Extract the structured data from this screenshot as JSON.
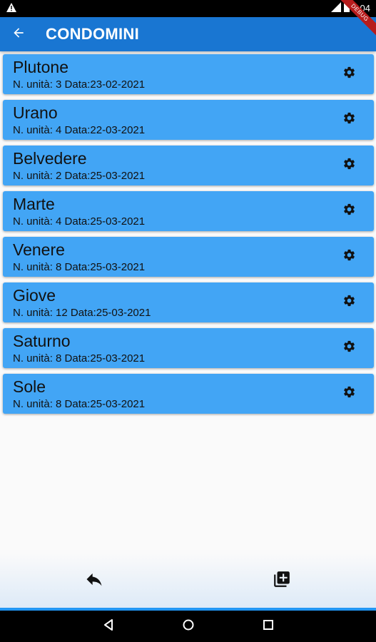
{
  "status_bar": {
    "time": "6:04",
    "debug_label": "DEBUG"
  },
  "app_bar": {
    "title": "CONDOMINI"
  },
  "condomini": [
    {
      "name": "Plutone",
      "details": "N. unità: 3 Data:23-02-2021"
    },
    {
      "name": "Urano",
      "details": "N. unità: 4 Data:22-03-2021"
    },
    {
      "name": "Belvedere",
      "details": "N. unità: 2 Data:25-03-2021"
    },
    {
      "name": "Marte",
      "details": "N. unità: 4 Data:25-03-2021"
    },
    {
      "name": "Venere",
      "details": "N. unità: 8 Data:25-03-2021"
    },
    {
      "name": "Giove",
      "details": "N. unità: 12 Data:25-03-2021"
    },
    {
      "name": "Saturno",
      "details": "N. unità: 8 Data:25-03-2021"
    },
    {
      "name": "Sole",
      "details": "N. unità: 8 Data:25-03-2021"
    }
  ],
  "icons": {
    "back": "arrow-back-icon",
    "settings": "gear-icon",
    "undo": "reply-icon",
    "add": "library-add-icon"
  },
  "colors": {
    "app_bar": "#1976d2",
    "list_item": "#42a5f5",
    "accent": "#2196f3"
  }
}
